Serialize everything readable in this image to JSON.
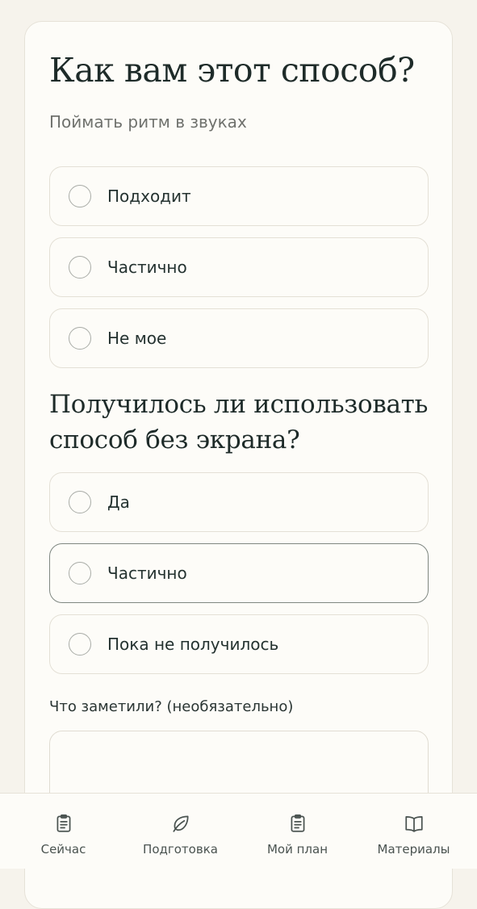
{
  "question1": {
    "title": "Как вам этот способ?",
    "subtitle": "Поймать ритм в звуках",
    "options": [
      {
        "label": "Подходит"
      },
      {
        "label": "Частично"
      },
      {
        "label": "Не мое"
      }
    ]
  },
  "question2": {
    "title": "Получилось ли использовать способ без экрана?",
    "options": [
      {
        "label": "Да"
      },
      {
        "label": "Частично"
      },
      {
        "label": "Пока не получилось"
      }
    ]
  },
  "notes": {
    "label": "Что заметили? (необязательно)",
    "value": ""
  },
  "nav": {
    "items": [
      {
        "label": "Сейчас",
        "icon": "clipboard-icon"
      },
      {
        "label": "Подготовка",
        "icon": "leaf-icon"
      },
      {
        "label": "Мой план",
        "icon": "clipboard-icon"
      },
      {
        "label": "Материалы",
        "icon": "book-icon"
      }
    ]
  },
  "colors": {
    "background": "#f6f3ec",
    "card": "#fdfcf8",
    "text": "#1e2b29",
    "muted": "#6f716d",
    "border": "#e4e0d6"
  }
}
